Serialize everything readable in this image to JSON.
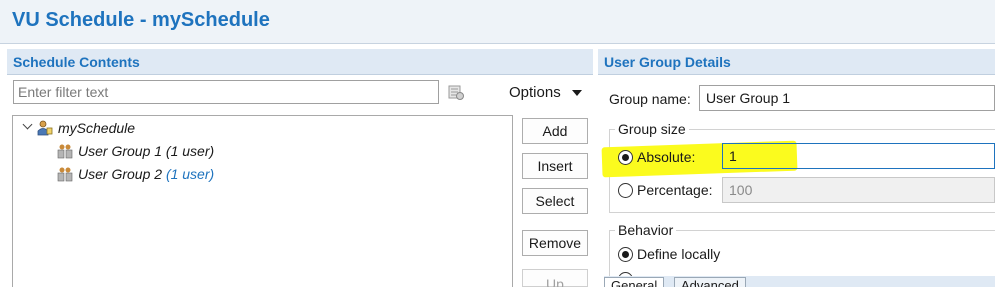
{
  "window": {
    "title": "VU Schedule - mySchedule"
  },
  "left_panel": {
    "header": "Schedule Contents",
    "filter": {
      "placeholder": "Enter filter text",
      "value": ""
    },
    "options_label": "Options",
    "tree": {
      "root": "mySchedule",
      "items": [
        {
          "label": "User Group 1 (1 user)",
          "count": ""
        },
        {
          "label": "User Group 2",
          "count": "(1 user)"
        }
      ]
    },
    "buttons": {
      "add": "Add",
      "insert": "Insert",
      "select": "Select",
      "remove": "Remove",
      "up": "Up"
    }
  },
  "right_panel": {
    "header": "User Group Details",
    "group_name": {
      "label": "Group name:",
      "value": "User Group 1"
    },
    "group_size": {
      "title": "Group size",
      "absolute": {
        "label": "Absolute:",
        "value": "1",
        "selected": true
      },
      "percentage": {
        "label": "Percentage:",
        "value": "100",
        "selected": false
      }
    },
    "behavior": {
      "title": "Behavior",
      "define_locally": "Define locally"
    },
    "tabs": {
      "general": "General",
      "advanced": "Advanced"
    }
  },
  "colors": {
    "accent": "#1e73be",
    "highlight": "#fbfb1e",
    "header_bg": "#dfe9f4"
  }
}
